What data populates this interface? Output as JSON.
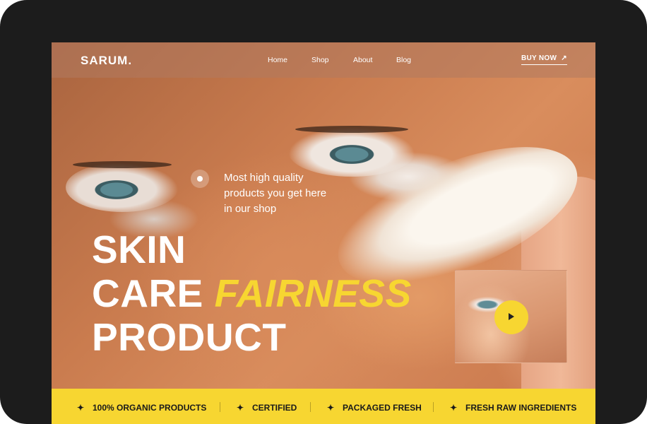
{
  "nav": {
    "logo": "SARUM.",
    "links": [
      "Home",
      "Shop",
      "About",
      "Blog"
    ],
    "cta_label": "BUY NOW",
    "cta_icon": "arrow-up-right-icon"
  },
  "hero": {
    "tagline": [
      "Most high quality",
      "products you get here",
      "in our shop"
    ],
    "headline": {
      "line1": "SKIN",
      "line2_a": "CARE",
      "line2_accent": "FAIRNESS",
      "line3": "PRODUCT"
    },
    "video_thumb": {
      "play_icon": "play-icon"
    }
  },
  "features": [
    {
      "icon": "sparkle-icon",
      "label": "100% ORGANIC PRODUCTS"
    },
    {
      "icon": "sparkle-icon",
      "label": "CERTIFIED"
    },
    {
      "icon": "sparkle-icon",
      "label": "PACKAGED FRESH"
    },
    {
      "icon": "sparkle-icon",
      "label": "FRESH RAW INGREDIENTS"
    }
  ],
  "colors": {
    "accent": "#f7d631",
    "frame": "#1c1c1c",
    "text": "#ffffff"
  }
}
